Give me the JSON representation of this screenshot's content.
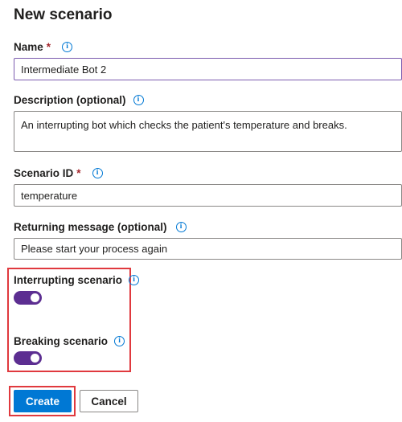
{
  "page": {
    "title": "New scenario"
  },
  "form": {
    "name": {
      "label": "Name",
      "required_mark": "*",
      "value": "Intermediate Bot 2"
    },
    "description": {
      "label": "Description (optional)",
      "value": "An interrupting bot which checks the patient's temperature and breaks."
    },
    "scenario_id": {
      "label": "Scenario ID",
      "required_mark": "*",
      "value": "temperature"
    },
    "returning_message": {
      "label": "Returning message (optional)",
      "value": "Please start your process again"
    },
    "interrupting": {
      "label": "Interrupting scenario",
      "state": "on"
    },
    "breaking": {
      "label": "Breaking scenario",
      "state": "on"
    }
  },
  "icons": {
    "info": "i"
  },
  "buttons": {
    "create": "Create",
    "cancel": "Cancel"
  },
  "colors": {
    "accent": "#0078d4",
    "toggle_on": "#5c2e91",
    "highlight": "#e0393e",
    "required": "#a4262c"
  }
}
